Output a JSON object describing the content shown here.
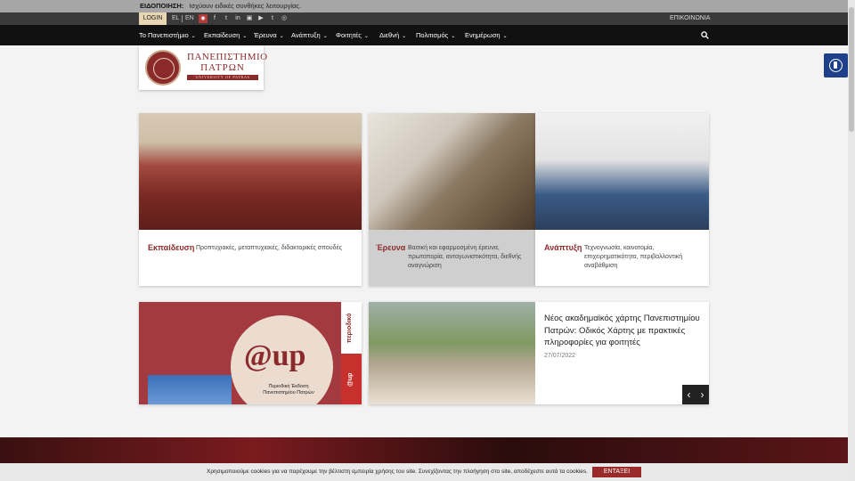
{
  "notice": {
    "label": "ΕΙΔΟΠΟΙΗΣΗ:",
    "text": "Ισχύουν ειδικές συνθήκες λειτουργίας."
  },
  "utility": {
    "login": "LOGIN",
    "lang_el": "EL",
    "lang_en": "EN",
    "contact": "ΕΠΙΚΟΙΝΩΝΙΑ",
    "social_icons": [
      "rss-icon",
      "facebook-icon",
      "twitter-icon",
      "linkedin-icon",
      "flickr-icon",
      "youtube-icon",
      "tumblr-icon",
      "instagram-icon"
    ]
  },
  "nav": {
    "items": [
      "Το Πανεπιστήμιο",
      "Εκπαίδευση",
      "Έρευνα",
      "Ανάπτυξη",
      "Φοιτητές",
      "Διεθνή",
      "Πολιτισμός",
      "Ενημέρωση"
    ]
  },
  "logo": {
    "line1": "ΠΑΝΕΠΙΣΤΗΜΙΟ",
    "line2": "ΠΑΤΡΩΝ",
    "line3": "UNIVERSITY OF PATRAS"
  },
  "cards": [
    {
      "title": "Εκπαίδευση",
      "desc": "Προπτυχιακές, μεταπτυχιακές, διδακτορικές σπουδές"
    },
    {
      "title": "Έρευνα",
      "desc": "Βασική και εφαρμοσμένη έρευνα, πρωτοπορία, ανταγωνιστικότητα, διεθνής αναγνώριση"
    },
    {
      "title": "Ανάπτυξη",
      "desc": "Τεχνογνωσία, καινοτομία, επιχειρηματικότητα, περιβαλλοντική αναβάθμιση"
    }
  ],
  "up_banner": {
    "logo": "@up",
    "subtitle1": "Περιοδική Έκδοση",
    "subtitle2": "Πανεπιστημίου Πατρών",
    "side_top": "περιοδικό",
    "side_bottom": "@up"
  },
  "news": {
    "title": "Νέος ακαδημαϊκός χάρτης Πανεπιστημίου Πατρών: Οδικός Χάρτης με πρακτικές πληροφορίες για φοιτητές",
    "date": "27/07/2022"
  },
  "cookie": {
    "text": "Χρησιμοποιούμε cookies για να παρέχουμε την βέλτιστη εμπειρία χρήσης του site. Συνεχίζοντας την πλοήγηση στο site, αποδέχεστε αυτά τα cookies.",
    "button": "ΕΝΤΑΞΕΙ"
  },
  "colors": {
    "brand": "#8b2a2a",
    "nav_bg": "#111111",
    "accessibility": "#1e3f8a"
  }
}
